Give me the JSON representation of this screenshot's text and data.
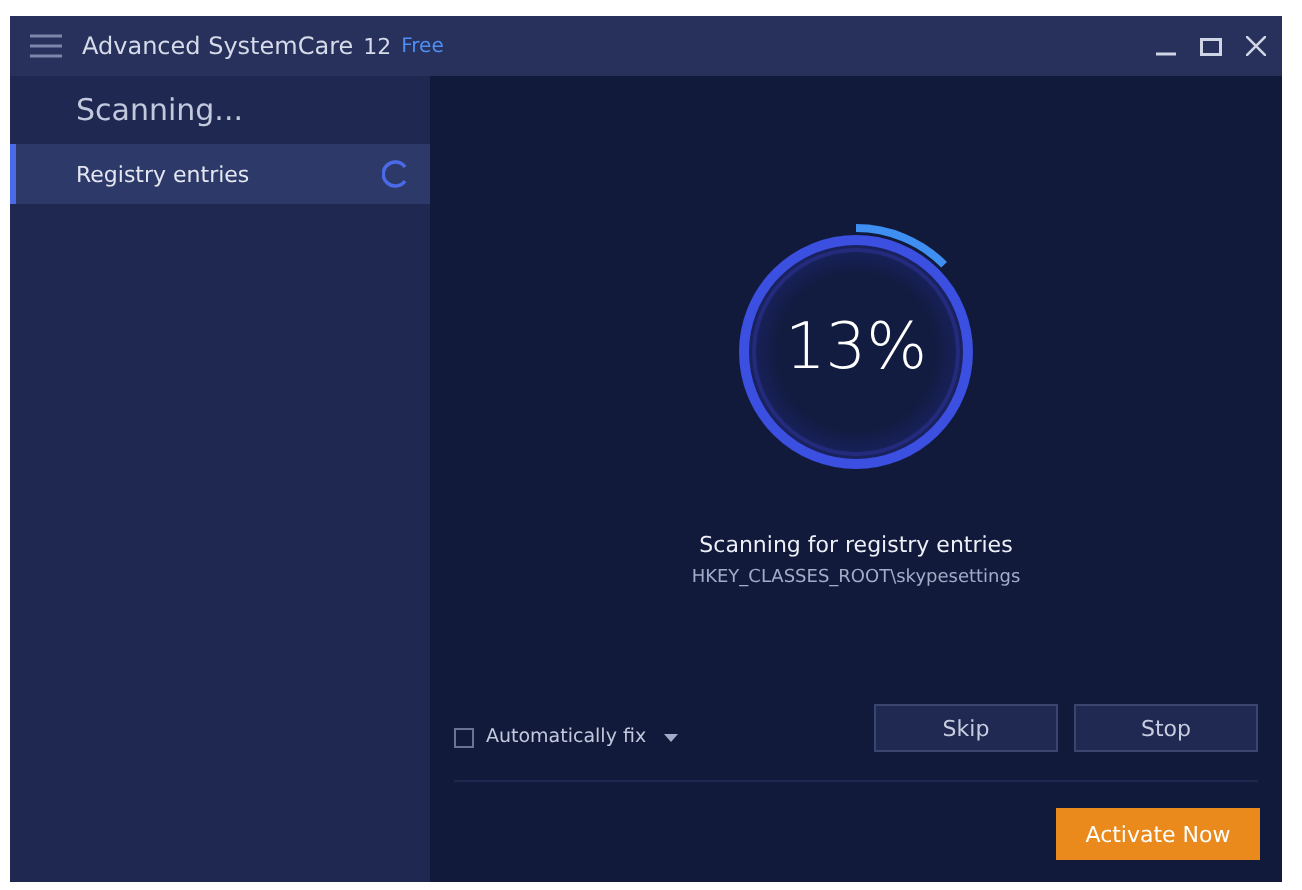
{
  "window": {
    "title": "Advanced SystemCare",
    "version": "12",
    "edition": "Free"
  },
  "sidebar": {
    "heading": "Scanning...",
    "items": [
      {
        "label": "Registry entries",
        "selected": true,
        "scanning": true
      }
    ]
  },
  "progress": {
    "level": 0.13,
    "percent": "13%"
  },
  "status": "Scanning for registry entries",
  "current_path": "HKEY_CLASSES_ROOT\\skypesettings",
  "auto_fix": {
    "label": "Automatically fix",
    "checked": false
  },
  "buttons": [
    "Skip",
    "Stop"
  ],
  "activate_button": "Activate Now"
}
